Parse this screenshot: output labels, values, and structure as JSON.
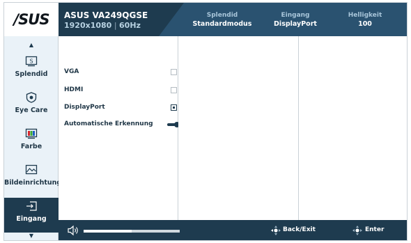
{
  "header": {
    "brand": "/SUS",
    "model": "ASUS VA249QGSE",
    "resolution": "1920x1080",
    "refresh": "60Hz",
    "status": [
      {
        "label": "Splendid",
        "value": "Standardmodus"
      },
      {
        "label": "Eingang",
        "value": "DisplayPort"
      },
      {
        "label": "Helligkeit",
        "value": "100"
      }
    ]
  },
  "sidebar": {
    "items": [
      {
        "label": "Splendid",
        "icon": "splendid-icon",
        "active": false
      },
      {
        "label": "Eye Care",
        "icon": "eye-care-icon",
        "active": false
      },
      {
        "label": "Farbe",
        "icon": "color-icon",
        "active": false
      },
      {
        "label": "Bildeinrichtung",
        "icon": "image-setup-icon",
        "active": false
      },
      {
        "label": "Eingang",
        "icon": "input-icon",
        "active": true
      }
    ]
  },
  "input_menu": {
    "options": [
      {
        "label": "VGA",
        "selected": false
      },
      {
        "label": "HDMI",
        "selected": false
      },
      {
        "label": "DisplayPort",
        "selected": true
      },
      {
        "label": "Automatische Erkennung",
        "toggle_on": true
      }
    ]
  },
  "footer": {
    "volume_level": 0.5,
    "back_label": "Back/Exit",
    "enter_label": "Enter"
  },
  "colors": {
    "header_dark": "#1e3b4f",
    "header_light": "#2a5270",
    "sidebar_bg": "#eaf2f8",
    "accent": "#1e3b4f"
  }
}
